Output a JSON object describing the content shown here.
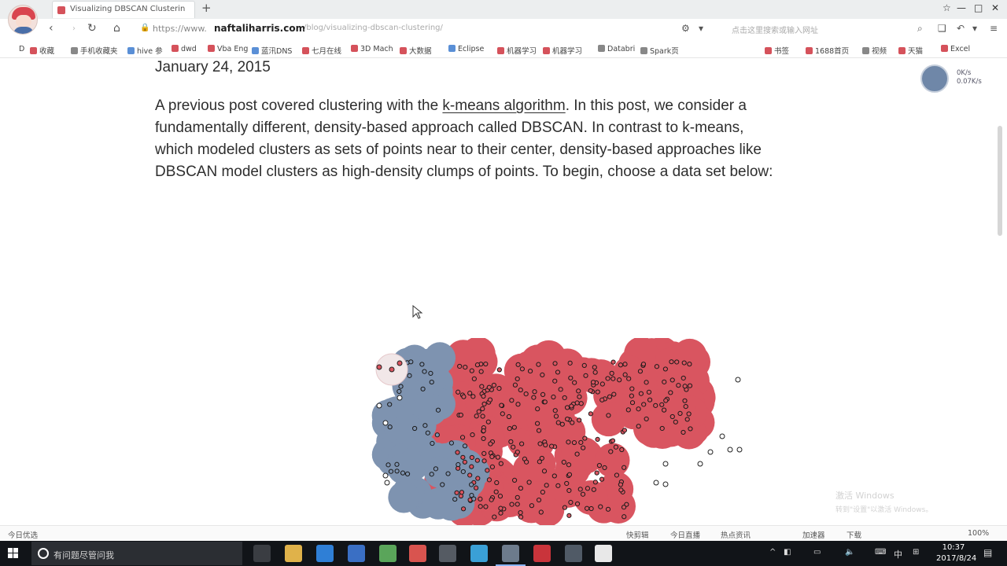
{
  "browser": {
    "tab_title": "Visualizing DBSCAN Clusterin",
    "new_tab": "+",
    "window_controls": [
      "☆",
      "—",
      "□",
      "✕"
    ],
    "address": {
      "proto": "https://www.",
      "host": "naftaliharris.com",
      "path": "/blog/visualizing-dbscan-clustering/"
    },
    "search_hint": "点击这里搜索或输入网址",
    "bookmarks": [
      {
        "label": "D",
        "color": "#ffffff"
      },
      {
        "label": "收藏",
        "color": "#d5525b"
      },
      {
        "label": "手机收藏夹",
        "color": "#888888"
      },
      {
        "label": "hive 参",
        "color": "#5a8fd6"
      },
      {
        "label": "dwd",
        "color": "#d5525b"
      },
      {
        "label": "Vba Eng",
        "color": "#d5525b"
      },
      {
        "label": "蓝汛DNS",
        "color": "#5a8fd6"
      },
      {
        "label": "七月在线",
        "color": "#d5525b"
      },
      {
        "label": "3D Mach",
        "color": "#d5525b"
      },
      {
        "label": "大数据",
        "color": "#d5525b"
      },
      {
        "label": "Eclipse",
        "color": "#5a8fd6"
      },
      {
        "label": "机器学习",
        "color": "#d5525b"
      },
      {
        "label": "机器学习",
        "color": "#d5525b"
      },
      {
        "label": "Databri",
        "color": "#888888"
      },
      {
        "label": "Spark页",
        "color": "#888888"
      },
      {
        "label": "书签",
        "color": "#d5525b"
      },
      {
        "label": "1688首页",
        "color": "#d5525b"
      },
      {
        "label": "视频",
        "color": "#888888"
      },
      {
        "label": "天猫",
        "color": "#d5525b"
      },
      {
        "label": "Excel",
        "color": "#d5525b"
      }
    ],
    "speed": {
      "up": "0K/s",
      "down": "0.07K/s"
    }
  },
  "page": {
    "date": "January 24, 2015",
    "intro_before": "A previous post covered clustering with the ",
    "intro_link": "k-means algorithm",
    "intro_after": ". In this post, we consider a fundamentally different, density-based approach called DBSCAN. In contrast to k-means, which modeled clusters as sets of points near to their center, density-based approaches like DBSCAN model clusters as high-density clumps of points. To begin, choose a data set below:",
    "watermark": [
      "激活 Windows",
      "转到\"设置\"以激活 Windows。"
    ]
  },
  "status_bar": {
    "left": "今日优选",
    "items": [
      "快剪辑",
      "今日直播",
      "热点资讯",
      "加速器",
      "下载",
      "100%"
    ]
  },
  "taskbar": {
    "search_text": "有问题尽管问我",
    "clock_time": "10:37",
    "clock_date": "2017/8/24",
    "ime": "中",
    "apps": [
      {
        "name": "task-view",
        "color": "#3a3d42"
      },
      {
        "name": "explorer",
        "color": "#e0b24a"
      },
      {
        "name": "edge",
        "color": "#2f7fd6"
      },
      {
        "name": "store",
        "color": "#3a6fc4"
      },
      {
        "name": "app-green",
        "color": "#5aa55a"
      },
      {
        "name": "chrome",
        "color": "#d9544f"
      },
      {
        "name": "app-dark",
        "color": "#555b63"
      },
      {
        "name": "browser-360",
        "color": "#3aa0d6"
      },
      {
        "name": "active-app",
        "color": "#6d7b8c"
      },
      {
        "name": "app-red",
        "color": "#c9343b"
      },
      {
        "name": "app-slate",
        "color": "#505a66"
      },
      {
        "name": "app-white",
        "color": "#e8e8e8"
      }
    ]
  },
  "colors": {
    "cluster_red": "#d95560",
    "cluster_blue": "#7e93b0",
    "noise": "#ffffff"
  }
}
